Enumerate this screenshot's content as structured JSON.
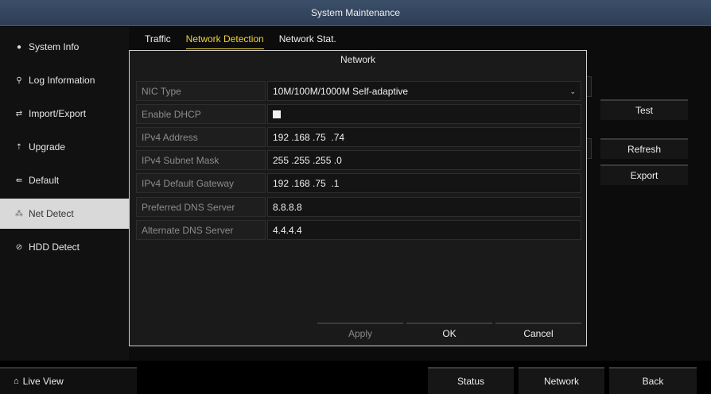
{
  "window": {
    "title": "System Maintenance"
  },
  "sidebar": {
    "items": [
      {
        "label": "System Info",
        "icon": "info-dot-icon"
      },
      {
        "label": "Log Information",
        "icon": "log-icon"
      },
      {
        "label": "Import/Export",
        "icon": "import-export-icon"
      },
      {
        "label": "Upgrade",
        "icon": "upgrade-icon"
      },
      {
        "label": "Default",
        "icon": "default-icon"
      },
      {
        "label": "Net Detect",
        "icon": "net-detect-icon",
        "active": true
      },
      {
        "label": "HDD Detect",
        "icon": "hdd-detect-icon"
      }
    ]
  },
  "tabs": [
    {
      "label": "Traffic"
    },
    {
      "label": "Network Detection",
      "active": true
    },
    {
      "label": "Network Stat."
    }
  ],
  "panel_buttons": {
    "test": "Test",
    "refresh": "Refresh",
    "export": "Export"
  },
  "modal": {
    "title": "Network",
    "fields": {
      "nic_type": {
        "label": "NIC Type",
        "value": "10M/100M/1000M Self-adaptive"
      },
      "enable_dhcp": {
        "label": "Enable DHCP",
        "checked": true
      },
      "ipv4_address": {
        "label": "IPv4 Address",
        "value": "192 .168 .75  .74"
      },
      "ipv4_subnet_mask": {
        "label": "IPv4 Subnet Mask",
        "value": "255 .255 .255 .0"
      },
      "ipv4_default_gateway": {
        "label": "IPv4 Default Gateway",
        "value": "192 .168 .75  .1"
      },
      "preferred_dns": {
        "label": "Preferred DNS Server",
        "value": "8.8.8.8"
      },
      "alternate_dns": {
        "label": "Alternate DNS Server",
        "value": "4.4.4.4"
      }
    },
    "buttons": {
      "apply": "Apply",
      "ok": "OK",
      "cancel": "Cancel"
    }
  },
  "footer": {
    "live_view": "Live View",
    "status": "Status",
    "network": "Network",
    "back": "Back"
  },
  "colors": {
    "accent_tab": "#f2d23a",
    "titlebar": "#34465f",
    "active_sidebar": "#d9d9d9"
  }
}
